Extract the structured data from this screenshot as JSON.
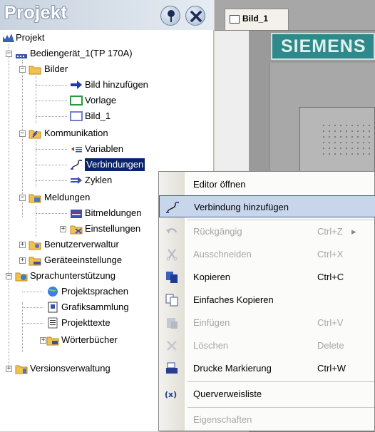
{
  "panel": {
    "title": "Projekt",
    "pin_icon": "pin-icon",
    "close_icon": "close-icon"
  },
  "tree": {
    "items": [
      {
        "label": "Projekt",
        "icon": "project-icon"
      },
      {
        "label": "Bediengerät_1(TP 170A)",
        "icon": "device-icon",
        "expander": "−"
      },
      {
        "label": "Bilder",
        "icon": "folder-icon",
        "expander": "−"
      },
      {
        "label": "Bild hinzufügen",
        "icon": "add-arrow-icon"
      },
      {
        "label": "Vorlage",
        "icon": "template-icon"
      },
      {
        "label": "Bild_1",
        "icon": "screen-icon"
      },
      {
        "label": "Kommunikation",
        "icon": "communication-icon",
        "expander": "−"
      },
      {
        "label": "Variablen",
        "icon": "variables-icon"
      },
      {
        "label": "Verbindungen",
        "icon": "connections-icon",
        "selected": true
      },
      {
        "label": "Zyklen",
        "icon": "cycles-icon"
      },
      {
        "label": "Meldungen",
        "icon": "folder-icon",
        "expander": "−"
      },
      {
        "label": "Bitmeldungen",
        "icon": "bitmessage-icon"
      },
      {
        "label": "Einstellungen",
        "icon": "settings-icon",
        "expander": "+"
      },
      {
        "label": "Benutzerverwaltur",
        "icon": "folder-icon",
        "expander": "+"
      },
      {
        "label": "Geräteeinstellunge",
        "icon": "folder-icon",
        "expander": "+"
      },
      {
        "label": "Sprachunterstützung",
        "icon": "folder-icon",
        "expander": "−"
      },
      {
        "label": "Projektsprachen",
        "icon": "globe-icon"
      },
      {
        "label": "Grafiksammlung",
        "icon": "graphics-icon"
      },
      {
        "label": "Projekttexte",
        "icon": "texts-icon"
      },
      {
        "label": "Wörterbücher",
        "icon": "dictionary-icon",
        "expander": "+"
      },
      {
        "label": "Versionsverwaltung",
        "icon": "version-icon",
        "expander": "+"
      }
    ]
  },
  "editor": {
    "tab_label": "Bild_1",
    "siemens": "SIEMENS"
  },
  "menu": {
    "items": [
      {
        "label": "Editor öffnen",
        "shortcut": "",
        "enabled": true
      },
      {
        "label": "Verbindung hinzufügen",
        "shortcut": "",
        "enabled": true,
        "highlight": true
      },
      {
        "label": "Rückgängig",
        "shortcut": "Ctrl+Z",
        "enabled": false,
        "submenu_arrow": "▸"
      },
      {
        "label": "Ausschneiden",
        "shortcut": "Ctrl+X",
        "enabled": false
      },
      {
        "label": "Kopieren",
        "shortcut": "Ctrl+C",
        "enabled": true
      },
      {
        "label": "Einfaches Kopieren",
        "shortcut": "",
        "enabled": true
      },
      {
        "label": "Einfügen",
        "shortcut": "Ctrl+V",
        "enabled": false
      },
      {
        "label": "Löschen",
        "shortcut": "Delete",
        "enabled": false
      },
      {
        "label": "Drucke Markierung",
        "shortcut": "Ctrl+W",
        "enabled": true
      },
      {
        "label": "Querverweisliste",
        "shortcut": "",
        "enabled": true
      },
      {
        "label": "Eigenschaften",
        "shortcut": "",
        "enabled": false
      }
    ]
  },
  "colors": {
    "selection": "#0a246a",
    "siemens_teal": "#2e8a8a",
    "menu_highlight": "#c8d6ec"
  }
}
